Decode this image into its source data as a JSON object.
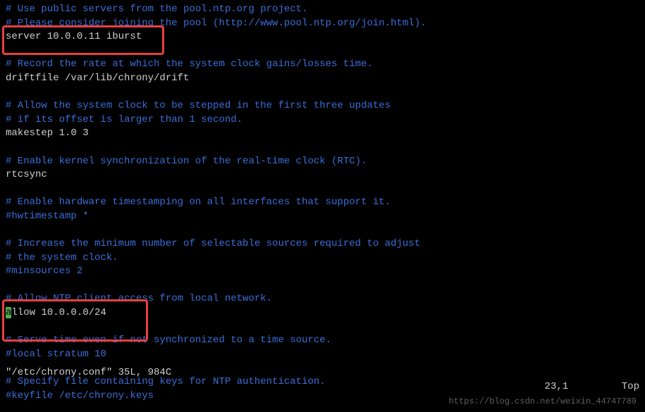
{
  "lines": [
    {
      "type": "comment",
      "text": "# Use public servers from the pool.ntp.org project."
    },
    {
      "type": "comment",
      "text": "# Please consider joining the pool (http://www.pool.ntp.org/join.html)."
    },
    {
      "type": "directive",
      "text": "server 10.0.0.11 iburst"
    },
    {
      "type": "blank",
      "text": ""
    },
    {
      "type": "comment",
      "text": "# Record the rate at which the system clock gains/losses time."
    },
    {
      "type": "directive",
      "text": "driftfile /var/lib/chrony/drift"
    },
    {
      "type": "blank",
      "text": ""
    },
    {
      "type": "comment",
      "text": "# Allow the system clock to be stepped in the first three updates"
    },
    {
      "type": "comment",
      "text": "# if its offset is larger than 1 second."
    },
    {
      "type": "directive",
      "text": "makestep 1.0 3"
    },
    {
      "type": "blank",
      "text": ""
    },
    {
      "type": "comment",
      "text": "# Enable kernel synchronization of the real-time clock (RTC)."
    },
    {
      "type": "directive",
      "text": "rtcsync"
    },
    {
      "type": "blank",
      "text": ""
    },
    {
      "type": "comment",
      "text": "# Enable hardware timestamping on all interfaces that support it."
    },
    {
      "type": "comment",
      "text": "#hwtimestamp *"
    },
    {
      "type": "blank",
      "text": ""
    },
    {
      "type": "comment",
      "text": "# Increase the minimum number of selectable sources required to adjust"
    },
    {
      "type": "comment",
      "text": "# the system clock."
    },
    {
      "type": "comment",
      "text": "#minsources 2"
    },
    {
      "type": "blank",
      "text": ""
    },
    {
      "type": "comment",
      "text": "# Allow NTP client access from local network."
    },
    {
      "type": "directive-cursor",
      "text": "allow 10.0.0.0/24"
    },
    {
      "type": "blank",
      "text": ""
    },
    {
      "type": "comment",
      "text": "# Serve time even if not synchronized to a time source."
    },
    {
      "type": "comment",
      "text": "#local stratum 10"
    },
    {
      "type": "blank",
      "text": ""
    },
    {
      "type": "comment",
      "text": "# Specify file containing keys for NTP authentication."
    },
    {
      "type": "comment",
      "text": "#keyfile /etc/chrony.keys"
    }
  ],
  "status": {
    "left": "\"/etc/chrony.conf\" 35L, 984C",
    "right_pos": "23,1",
    "right_mode": "Top"
  },
  "watermark": "https://blog.csdn.net/weixin_44747789"
}
